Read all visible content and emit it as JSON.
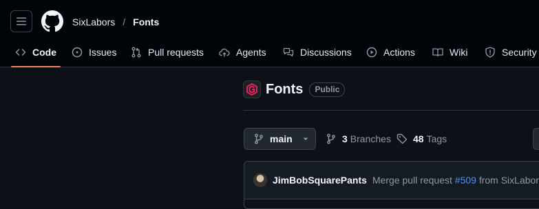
{
  "header": {
    "owner": "SixLabors",
    "separator": "/",
    "repo": "Fonts"
  },
  "tabs": [
    {
      "label": "Code",
      "icon": "code-icon",
      "active": true
    },
    {
      "label": "Issues",
      "icon": "issue-opened-icon"
    },
    {
      "label": "Pull requests",
      "icon": "git-pull-request-icon"
    },
    {
      "label": "Agents",
      "icon": "agent-icon"
    },
    {
      "label": "Discussions",
      "icon": "comment-discussion-icon"
    },
    {
      "label": "Actions",
      "icon": "play-icon"
    },
    {
      "label": "Wiki",
      "icon": "book-icon"
    },
    {
      "label": "Security",
      "icon": "shield-icon"
    }
  ],
  "repo": {
    "name": "Fonts",
    "visibility": "Public"
  },
  "branch": {
    "current": "main",
    "branches_count": "3",
    "branches_label": "Branches",
    "tags_count": "48",
    "tags_label": "Tags"
  },
  "commit": {
    "author": "JimBobSquarePants",
    "message_prefix": "Merge pull request ",
    "pr_number": "#509",
    "message_suffix": " from SixLabors/"
  },
  "colors": {
    "accent_underline": "#f78166",
    "link": "#4493f8",
    "brand_logo": "#e0245e"
  }
}
